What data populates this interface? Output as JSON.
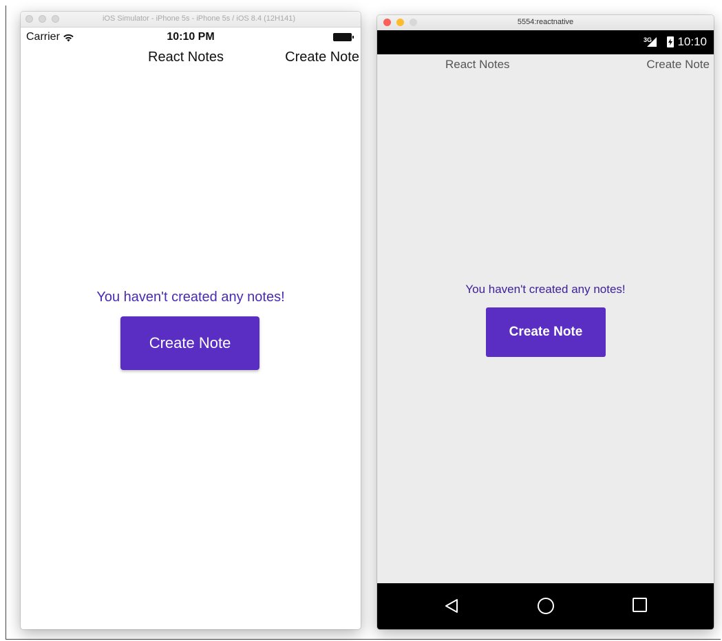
{
  "ios": {
    "window_title": "iOS Simulator - iPhone 5s - iPhone 5s / iOS 8.4 (12H141)",
    "status": {
      "carrier": "Carrier",
      "time": "10:10 PM"
    },
    "nav": {
      "title": "React Notes",
      "action": "Create Note"
    },
    "empty_message": "You haven't created any notes!",
    "create_button": "Create Note"
  },
  "android": {
    "window_title": "5554:reactnative",
    "status": {
      "network": "3G",
      "time": "10:10"
    },
    "nav": {
      "title": "React Notes",
      "action": "Create Note"
    },
    "empty_message": "You haven't created any notes!",
    "create_button": "Create Note"
  },
  "colors": {
    "accent": "#5a2ec2",
    "message_text": "#4a2ab0",
    "mac_close": "#fc5f57",
    "mac_minimize": "#fdbc2e",
    "mac_zoom_inactive": "#d8d8d8"
  }
}
